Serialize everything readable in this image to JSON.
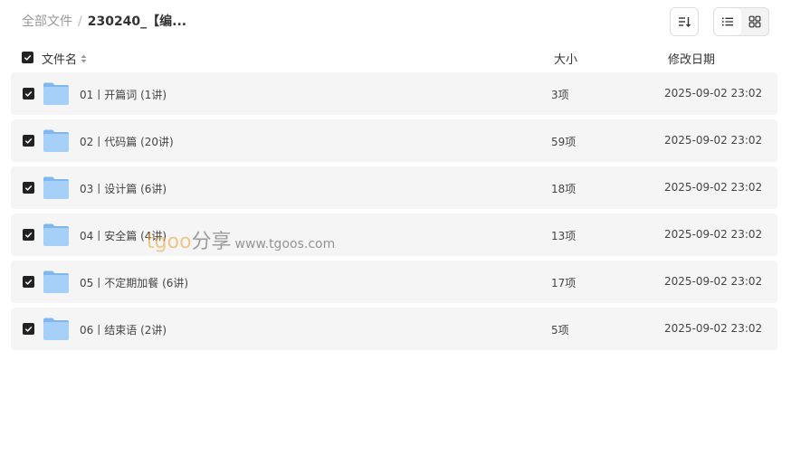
{
  "breadcrumb": {
    "root": "全部文件",
    "separator": "/",
    "current": "230240_【编..."
  },
  "toolbar": {
    "sort_icon": "sort-lines-icon",
    "view_list_icon": "list-view-icon",
    "view_grid_icon": "grid-view-icon",
    "active_view": "grid"
  },
  "table": {
    "columns": {
      "name": "文件名",
      "size": "大小",
      "modified": "修改日期"
    },
    "rows": [
      {
        "name": "01丨开篇词 (1讲)",
        "size": "3项",
        "modified": "2025-09-02 23:02"
      },
      {
        "name": "02丨代码篇 (20讲)",
        "size": "59项",
        "modified": "2025-09-02 23:02"
      },
      {
        "name": "03丨设计篇 (6讲)",
        "size": "18项",
        "modified": "2025-09-02 23:02"
      },
      {
        "name": "04丨安全篇 (4讲)",
        "size": "13项",
        "modified": "2025-09-02 23:02"
      },
      {
        "name": "05丨不定期加餐 (6讲)",
        "size": "17项",
        "modified": "2025-09-02 23:02"
      },
      {
        "name": "06丨结束语 (2讲)",
        "size": "5项",
        "modified": "2025-09-02 23:02"
      }
    ]
  },
  "watermark": {
    "logo_t": "t",
    "logo_goo": "goo",
    "logo_share": "分享",
    "url": "www.tgoos.com"
  },
  "colors": {
    "checkbox": "#222222",
    "folder": "#8cc4f5",
    "row_bg": "#f5f5f5"
  }
}
